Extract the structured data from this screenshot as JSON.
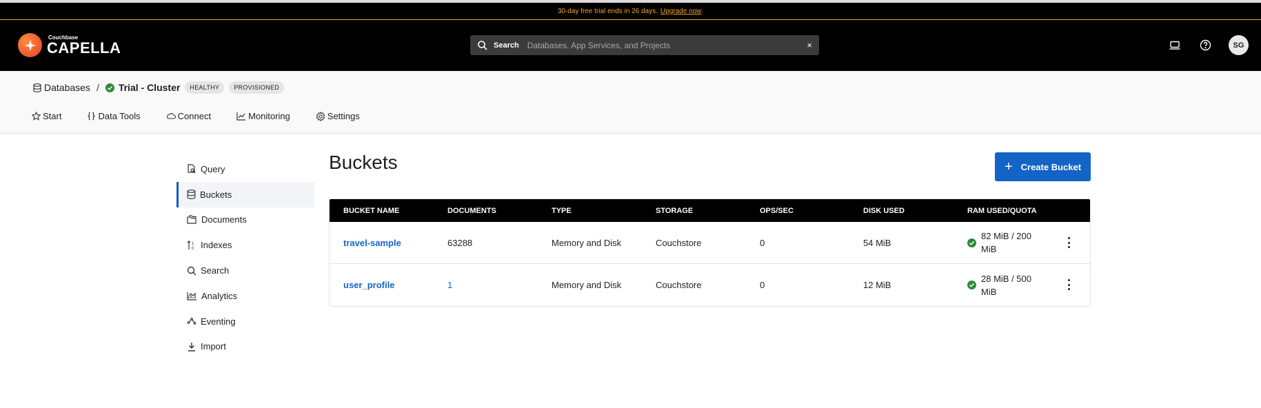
{
  "banner": {
    "text": "30-day free trial ends in 26 days.",
    "link": "Upgrade now",
    "suffix": "."
  },
  "brand": {
    "small": "Couchbase",
    "big": "CAPELLA"
  },
  "search": {
    "label": "Search",
    "placeholder": "Databases, App Services, and Projects",
    "clear": "×"
  },
  "user": {
    "initials": "SG"
  },
  "breadcrumb": {
    "root": "Databases",
    "separator": "/",
    "cluster": "Trial - Cluster"
  },
  "badges": [
    "HEALTHY",
    "PROVISIONED"
  ],
  "tabs": [
    {
      "label": "Start",
      "icon": "star-icon"
    },
    {
      "label": "Data Tools",
      "icon": "braces-icon"
    },
    {
      "label": "Connect",
      "icon": "cloud-icon"
    },
    {
      "label": "Monitoring",
      "icon": "chart-line-icon"
    },
    {
      "label": "Settings",
      "icon": "gear-icon"
    }
  ],
  "sidebar": {
    "items": [
      {
        "label": "Query",
        "icon": "query-icon"
      },
      {
        "label": "Buckets",
        "icon": "database-icon",
        "active": true
      },
      {
        "label": "Documents",
        "icon": "documents-icon"
      },
      {
        "label": "Indexes",
        "icon": "sort-icon"
      },
      {
        "label": "Search",
        "icon": "search-icon"
      },
      {
        "label": "Analytics",
        "icon": "analytics-icon"
      },
      {
        "label": "Eventing",
        "icon": "eventing-icon"
      },
      {
        "label": "Import",
        "icon": "download-icon"
      }
    ]
  },
  "main": {
    "title": "Buckets",
    "create_label": "Create Bucket",
    "columns": [
      "BUCKET NAME",
      "DOCUMENTS",
      "TYPE",
      "STORAGE",
      "OPS/SEC",
      "DISK USED",
      "RAM USED/QUOTA"
    ],
    "rows": [
      {
        "name": "travel-sample",
        "documents": "63288",
        "type": "Memory and Disk",
        "storage": "Couchstore",
        "ops": "0",
        "disk": "54 MiB",
        "ram": "82 MiB / 200 MiB"
      },
      {
        "name": "user_profile",
        "documents": "1",
        "type": "Memory and Disk",
        "storage": "Couchstore",
        "ops": "0",
        "disk": "12 MiB",
        "ram": "28 MiB / 500 MiB"
      }
    ]
  },
  "colors": {
    "accent": "#1264c7",
    "banner": "#f5a524",
    "healthy": "#2e8b3a"
  }
}
